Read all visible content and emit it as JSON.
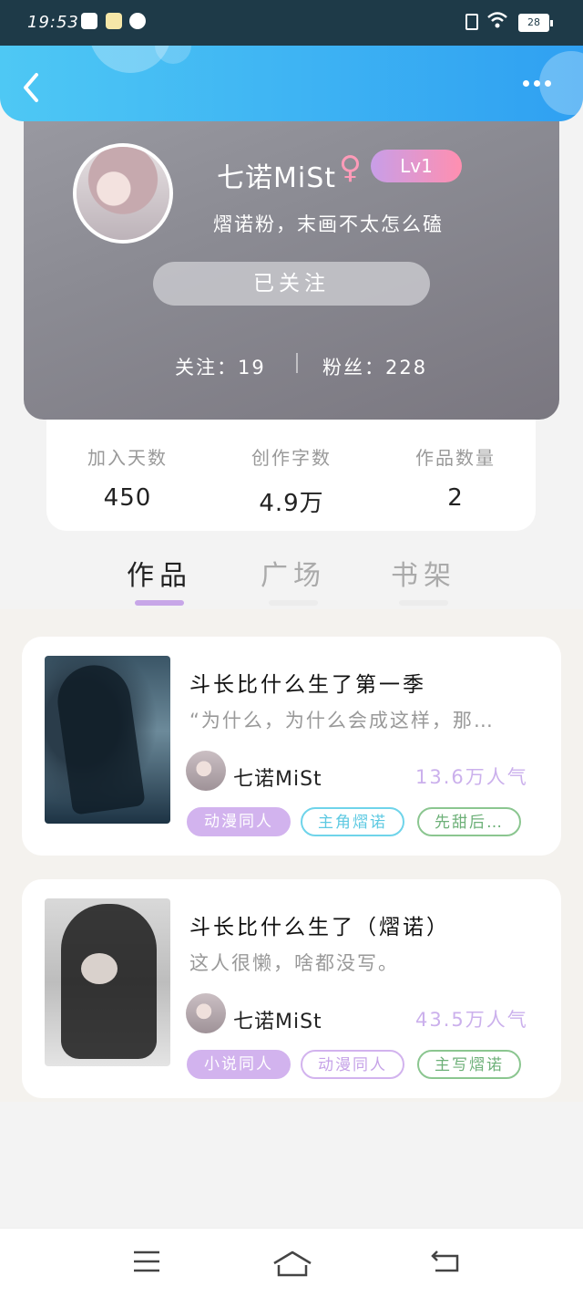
{
  "status_bar": {
    "time": "19:53",
    "battery": "28"
  },
  "header": {
    "back_icon": "chevron-left-icon",
    "more_icon": "more-dots-icon"
  },
  "profile": {
    "username": "七诺MiSt",
    "gender_symbol": "♀",
    "level": "Lv1",
    "signature": "熠诺粉，末画不太怎么磕",
    "follow_button": "已关注",
    "following_label": "关注：19",
    "fans_label": "粉丝：228"
  },
  "summary": [
    {
      "label": "加入天数",
      "value": "450"
    },
    {
      "label": "创作字数",
      "value": "4.9万"
    },
    {
      "label": "作品数量",
      "value": "2"
    }
  ],
  "tabs": [
    "作品",
    "广场",
    "书架"
  ],
  "works": [
    {
      "title": "斗长比什么生了第一季",
      "desc": "“为什么，为什么会成这样，那…",
      "author": "七诺MiSt",
      "popularity": "13.6万人气",
      "tags": [
        "动漫同人",
        "主角熠诺",
        "先甜后…"
      ]
    },
    {
      "title": "斗长比什么生了（熠诺）",
      "desc": "这人很懒，啥都没写。",
      "author": "七诺MiSt",
      "popularity": "43.5万人气",
      "tags": [
        "小说同人",
        "动漫同人",
        "主写熠诺"
      ]
    }
  ],
  "colors": {
    "header_gradient_start": "#4ec8f4",
    "header_gradient_end": "#2fa0f2",
    "accent_purple": "#c7a6e8",
    "level_gradient": [
      "#c89ee8",
      "#ff8fb0"
    ]
  }
}
